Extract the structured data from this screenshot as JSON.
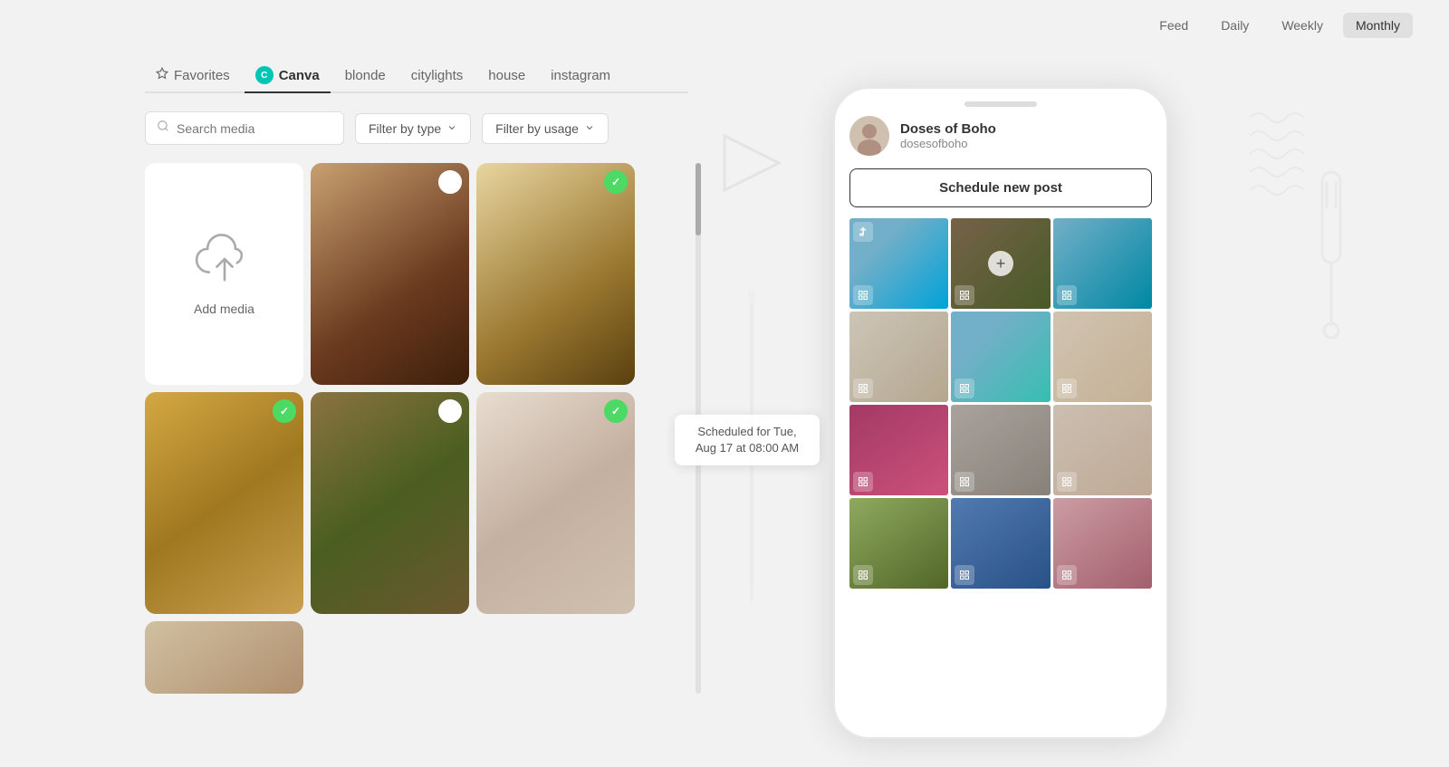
{
  "nav": {
    "items": [
      {
        "label": "Feed",
        "active": false
      },
      {
        "label": "Daily",
        "active": false
      },
      {
        "label": "Weekly",
        "active": false
      },
      {
        "label": "Monthly",
        "active": true
      }
    ]
  },
  "tabs": {
    "items": [
      {
        "label": "Favorites",
        "active": false,
        "has_star": true
      },
      {
        "label": "Canva",
        "active": true,
        "has_dot": true
      },
      {
        "label": "blonde",
        "active": false
      },
      {
        "label": "citylights",
        "active": false
      },
      {
        "label": "house",
        "active": false
      },
      {
        "label": "instagram",
        "active": false
      }
    ]
  },
  "search": {
    "placeholder": "Search media"
  },
  "filters": {
    "by_type": "Filter by type",
    "by_usage": "Filter by usage"
  },
  "add_media": {
    "label": "Add media"
  },
  "profile": {
    "name": "Doses of Boho",
    "handle": "dosesofboho"
  },
  "schedule": {
    "button_label": "Schedule new post",
    "tooltip": "Scheduled for Tue, Aug 17 at 08:00 AM"
  }
}
